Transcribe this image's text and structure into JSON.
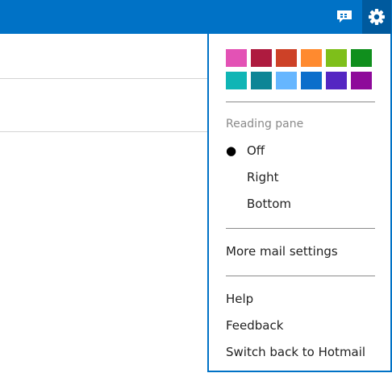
{
  "colors": {
    "brand": "#0072c6",
    "brand_dark": "#005a9e"
  },
  "toolbar": {
    "chat_icon": "chat-bubble-icon",
    "settings_icon": "gear-icon"
  },
  "theme_swatches": [
    "#e352b5",
    "#ae1b3f",
    "#cd4127",
    "#ff8a2f",
    "#7ebf1a",
    "#108f1d",
    "#10b5b5",
    "#0d8596",
    "#66b6ff",
    "#0b6ecb",
    "#5426c2",
    "#8e0a9a"
  ],
  "reading_pane": {
    "label": "Reading pane",
    "selected_marker": "●",
    "options": [
      {
        "label": "Off",
        "selected": true
      },
      {
        "label": "Right",
        "selected": false
      },
      {
        "label": "Bottom",
        "selected": false
      }
    ]
  },
  "links": {
    "more_settings": "More mail settings",
    "help": "Help",
    "feedback": "Feedback",
    "switch_back": "Switch back to Hotmail"
  }
}
